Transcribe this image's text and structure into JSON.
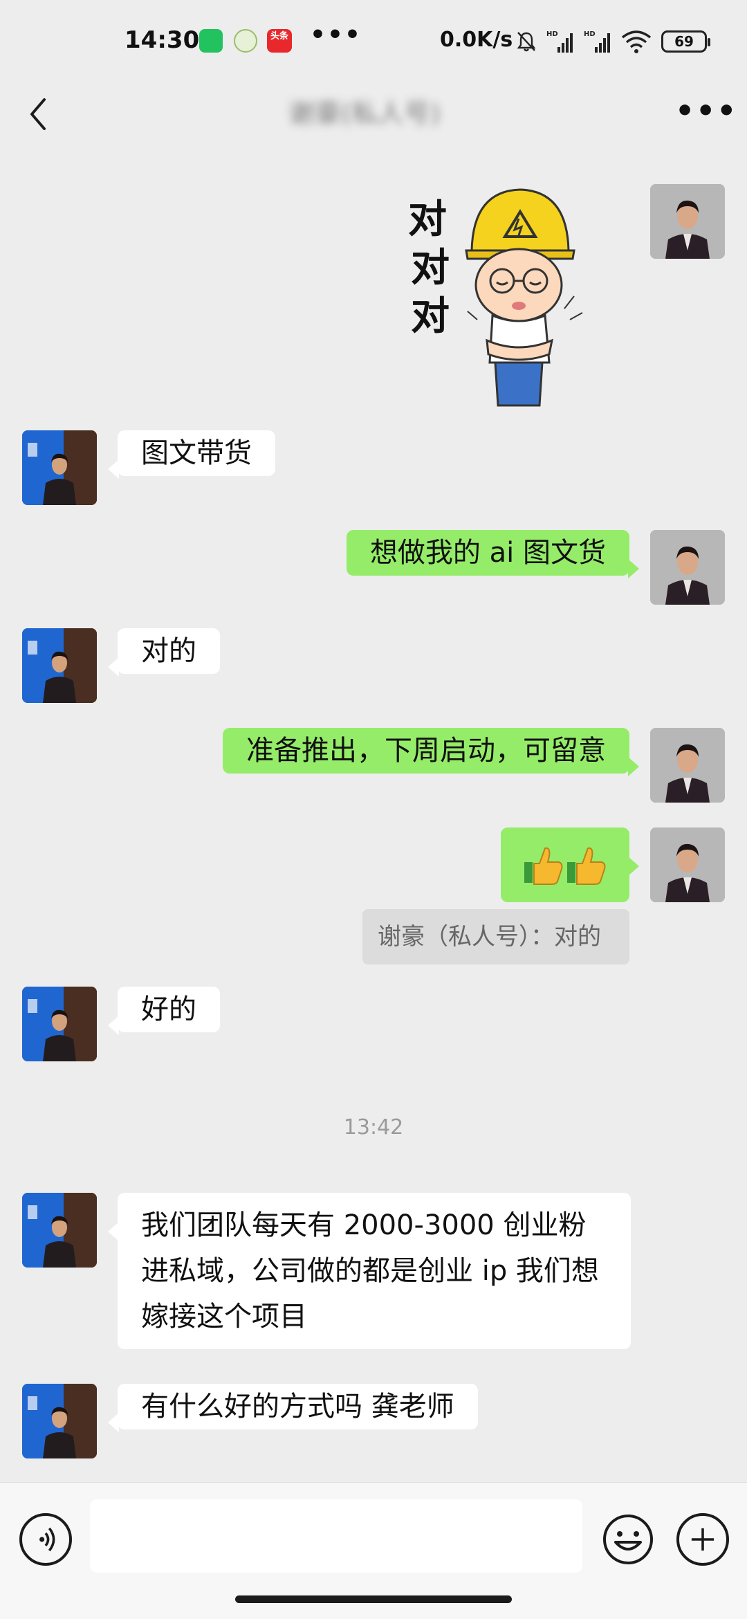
{
  "status_bar": {
    "time": "14:30",
    "app_badge_toutiao": "头条",
    "more": "•••",
    "net_speed": "0.0K/s",
    "signal_label": "HD",
    "battery": "69",
    "icons": [
      "wechat-icon",
      "gear-icon",
      "toutiao-icon",
      "mute-bell-icon",
      "signal-icon",
      "signal-icon",
      "wifi-icon",
      "battery-icon"
    ]
  },
  "header": {
    "title": "谢豪(私人号)",
    "more": "•••"
  },
  "messages": [
    {
      "side": "right",
      "type": "sticker",
      "text": "对\n对\n对"
    },
    {
      "side": "left",
      "type": "text",
      "text": "图文带货"
    },
    {
      "side": "right",
      "type": "text",
      "text": "想做我的 ai 图文货"
    },
    {
      "side": "left",
      "type": "text",
      "text": "对的"
    },
    {
      "side": "right",
      "type": "text",
      "text": "准备推出，下周启动，可留意"
    },
    {
      "side": "right",
      "type": "emoji",
      "text": "👍👍",
      "quote": "谢豪（私人号）：对的"
    },
    {
      "side": "left",
      "type": "text",
      "text": "好的"
    },
    {
      "type": "time",
      "text": "13:42"
    },
    {
      "side": "left",
      "type": "text",
      "text": "我们团队每天有 2000-3000 创业粉进私域，公司做的都是创业 ip 我们想嫁接这个项目"
    },
    {
      "side": "left",
      "type": "text",
      "text": "有什么好的方式吗 龚老师"
    }
  ],
  "colors": {
    "background": "#ededed",
    "bubble_out": "#95ec69",
    "bubble_in": "#ffffff",
    "quote_bg": "#dcdcdc"
  }
}
